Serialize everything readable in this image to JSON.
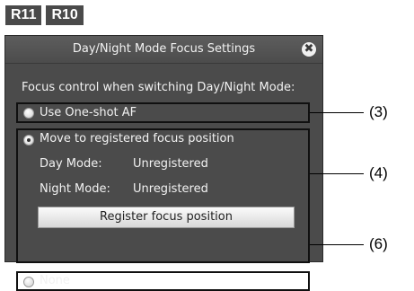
{
  "badges": [
    "R11",
    "R10"
  ],
  "dialog": {
    "title": "Day/Night Mode Focus Settings",
    "close_glyph": "✖",
    "heading": "Focus control when switching Day/Night Mode:",
    "options": [
      {
        "label": "Use One-shot AF",
        "selected": false
      },
      {
        "label": "Move to registered focus position",
        "selected": true
      },
      {
        "label": "None",
        "selected": false
      }
    ],
    "day_mode_label": "Day Mode:",
    "day_mode_value": "Unregistered",
    "night_mode_label": "Night Mode:",
    "night_mode_value": "Unregistered",
    "register_button": "Register focus position"
  },
  "callouts": [
    "(3)",
    "(4)",
    "(6)"
  ],
  "colors": {
    "dialog_bg": "#4b4b4b",
    "badge_bg": "#4a4a4a",
    "text": "#f2f2f2"
  }
}
